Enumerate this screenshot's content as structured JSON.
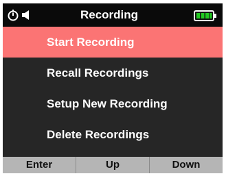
{
  "status_bar": {
    "title": "Recording",
    "icons": [
      "timer-icon",
      "speaker-icon",
      "battery-full-icon"
    ],
    "battery_color": "#22c922"
  },
  "menu": {
    "items": [
      {
        "label": "Start Recording",
        "selected": true
      },
      {
        "label": "Recall Recordings",
        "selected": false
      },
      {
        "label": "Setup New Recording",
        "selected": false
      },
      {
        "label": "Delete Recordings",
        "selected": false
      }
    ],
    "highlight_color": "#fb7474"
  },
  "softkeys": {
    "enter": "Enter",
    "up": "Up",
    "down": "Down"
  }
}
